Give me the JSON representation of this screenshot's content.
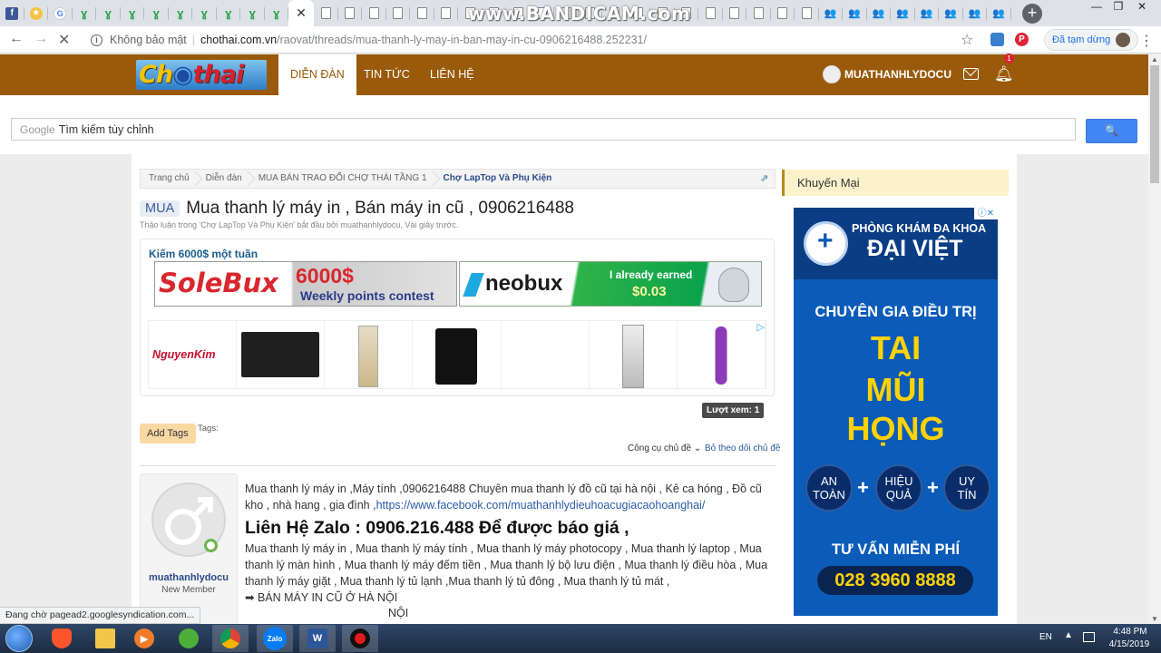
{
  "browser": {
    "watermark": "www.BANDICAM.com",
    "new_tab": "+",
    "win_min": "—",
    "win_max": "❐",
    "win_close": "✕",
    "tab_close": "✕",
    "security_label": "Không bảo mật",
    "url_host": "chothai.com.vn",
    "url_path": "/raovat/threads/mua-thanh-ly-may-in-ban-may-in-cu-0906216488.252231/",
    "paused_label": "Đã tạm dừng",
    "tabs": [
      {
        "icon": "facebook-icon",
        "glyph": "f"
      },
      {
        "icon": "star-icon",
        "glyph": "★"
      },
      {
        "icon": "google-icon",
        "glyph": "G"
      },
      {
        "icon": "leaf-icon",
        "glyph": "ɣ"
      },
      {
        "icon": "leaf-icon",
        "glyph": "ɣ"
      },
      {
        "icon": "leaf-icon",
        "glyph": "ɣ"
      },
      {
        "icon": "leaf-icon",
        "glyph": "ɣ"
      },
      {
        "icon": "leaf-icon",
        "glyph": "ɣ"
      },
      {
        "icon": "leaf-icon",
        "glyph": "ɣ"
      },
      {
        "icon": "leaf-icon",
        "glyph": "ɣ"
      },
      {
        "icon": "leaf-icon",
        "glyph": "ɣ"
      },
      {
        "icon": "leaf-icon",
        "glyph": "ɣ"
      },
      {
        "icon": "close-icon",
        "glyph": "✕",
        "active": true
      },
      {
        "icon": "document-icon",
        "glyph": ""
      },
      {
        "icon": "document-icon",
        "glyph": ""
      },
      {
        "icon": "document-icon",
        "glyph": ""
      },
      {
        "icon": "document-icon",
        "glyph": ""
      },
      {
        "icon": "document-icon",
        "glyph": ""
      },
      {
        "icon": "document-icon",
        "glyph": ""
      },
      {
        "icon": "document-icon",
        "glyph": ""
      },
      {
        "icon": "document-icon",
        "glyph": ""
      },
      {
        "icon": "document-icon",
        "glyph": ""
      },
      {
        "icon": "document-icon",
        "glyph": ""
      },
      {
        "icon": "document-icon",
        "glyph": ""
      },
      {
        "icon": "document-icon",
        "glyph": ""
      },
      {
        "icon": "document-icon",
        "glyph": ""
      },
      {
        "icon": "document-icon",
        "glyph": ""
      },
      {
        "icon": "document-icon",
        "glyph": ""
      },
      {
        "icon": "document-icon",
        "glyph": ""
      },
      {
        "icon": "document-icon",
        "glyph": ""
      },
      {
        "icon": "document-icon",
        "glyph": ""
      },
      {
        "icon": "document-icon",
        "glyph": ""
      },
      {
        "icon": "document-icon",
        "glyph": ""
      },
      {
        "icon": "document-icon",
        "glyph": ""
      },
      {
        "icon": "people-icon",
        "glyph": "👥"
      },
      {
        "icon": "people-icon",
        "glyph": "👥"
      },
      {
        "icon": "people-icon",
        "glyph": "👥"
      },
      {
        "icon": "people-icon",
        "glyph": "👥"
      },
      {
        "icon": "people-icon",
        "glyph": "👥"
      },
      {
        "icon": "people-icon",
        "glyph": "👥"
      },
      {
        "icon": "people-icon",
        "glyph": "👥"
      },
      {
        "icon": "people-icon",
        "glyph": "👥"
      }
    ],
    "status_text": "Đang chờ pagead2.googlesyndication.com..."
  },
  "site": {
    "logo_parts": [
      "Ch",
      "◉",
      "thai"
    ],
    "nav": {
      "forum": "DIỄN ĐÀN",
      "news": "TIN TỨC",
      "contact": "LIÊN HỆ"
    },
    "username": "MUATHANHLYDOCU",
    "notification_count": "1",
    "search": {
      "brand": "Google",
      "placeholder": "Tìm kiếm tùy chỉnh",
      "button_icon": "🔍"
    }
  },
  "breadcrumb": [
    "Trang chủ",
    "Diễn đàn",
    "MUA BÁN TRAO ĐỔI CHỢ THÁI TẦNG 1",
    "Chợ LapTop Và Phụ Kiện"
  ],
  "thread": {
    "prefix": "MUA",
    "title": "Mua thanh lý máy in , Bán máy in cũ , 0906216488",
    "meta": "Thảo luận trong 'Chợ LapTop Và Phụ Kiện' bắt đầu bởi muathanhlydocu, Vài giây trước.",
    "views": "Lượt xem: 1",
    "add_tags": "Add Tags",
    "tags_label": "Tags:",
    "tools": "Công cụ chủ đề",
    "watch": "Bỏ theo dõi chủ đề"
  },
  "ads": {
    "headline": "Kiếm 6000$ một tuần",
    "solebux": {
      "name": "SoleBux",
      "amount": "6000$",
      "sub": "Weekly points contest"
    },
    "neobux": {
      "name": "neobux",
      "line1": "I already earned",
      "line2": "$0.03"
    },
    "nguyenkim": "NguyenKim",
    "adchoices": "▷"
  },
  "post": {
    "author": "muathanhlydocu",
    "author_title": "New Member",
    "intro": "Mua thanh lý máy in ,Máy tính ,0906216488 Chuyên mua thanh lý đồ cũ tại hà nội , Kê ca hóng , Đồ cũ kho , nhà hang , gia đình ,",
    "link": "https://www.facebook.com/muathanhlydieuhoacugiacaohoanghai/",
    "contact": "Liên Hệ Zalo : 0906.216.488 Để được báo giá ,",
    "list": "Mua thanh lý máy in , Mua thanh lý máy tính , Mua thanh lý máy photocopy , Mua thanh lý laptop , Mua thanh lý màn hình , Mua thanh lý máy đếm tiền , Mua thanh lý bộ lưu điện , Mua thanh lý điều hòa , Mua thanh lý máy giặt , Mua thanh lý tủ lạnh ,Mua thanh lý tủ đông , Mua thanh lý tủ mát ,",
    "arrow_line": "➡ BÁN MÁY IN CŨ Ở HÀ NỘI",
    "noi": "NỘI"
  },
  "sidebar": {
    "heading": "Khuyến Mại",
    "clinic_line1": "PHÒNG KHÁM ĐA KHOA",
    "clinic_line2": "ĐẠI VIỆT",
    "ad_close": "ⓘ✕",
    "specialty": "CHUYÊN GIA ĐIỀU TRỊ",
    "big_lines": [
      "TAI",
      "MŨI",
      "HỌNG"
    ],
    "badges": [
      "AN\nTOÀN",
      "HIỆU\nQUẢ",
      "UY\nTÍN"
    ],
    "plus": "+",
    "consult": "TƯ VẤN MIỄN PHÍ",
    "hotline": "028 3960 8888"
  },
  "taskbar": {
    "zalo": "Zalo",
    "word": "W",
    "lang": "EN",
    "time": "4:48 PM",
    "date": "4/15/2019"
  }
}
